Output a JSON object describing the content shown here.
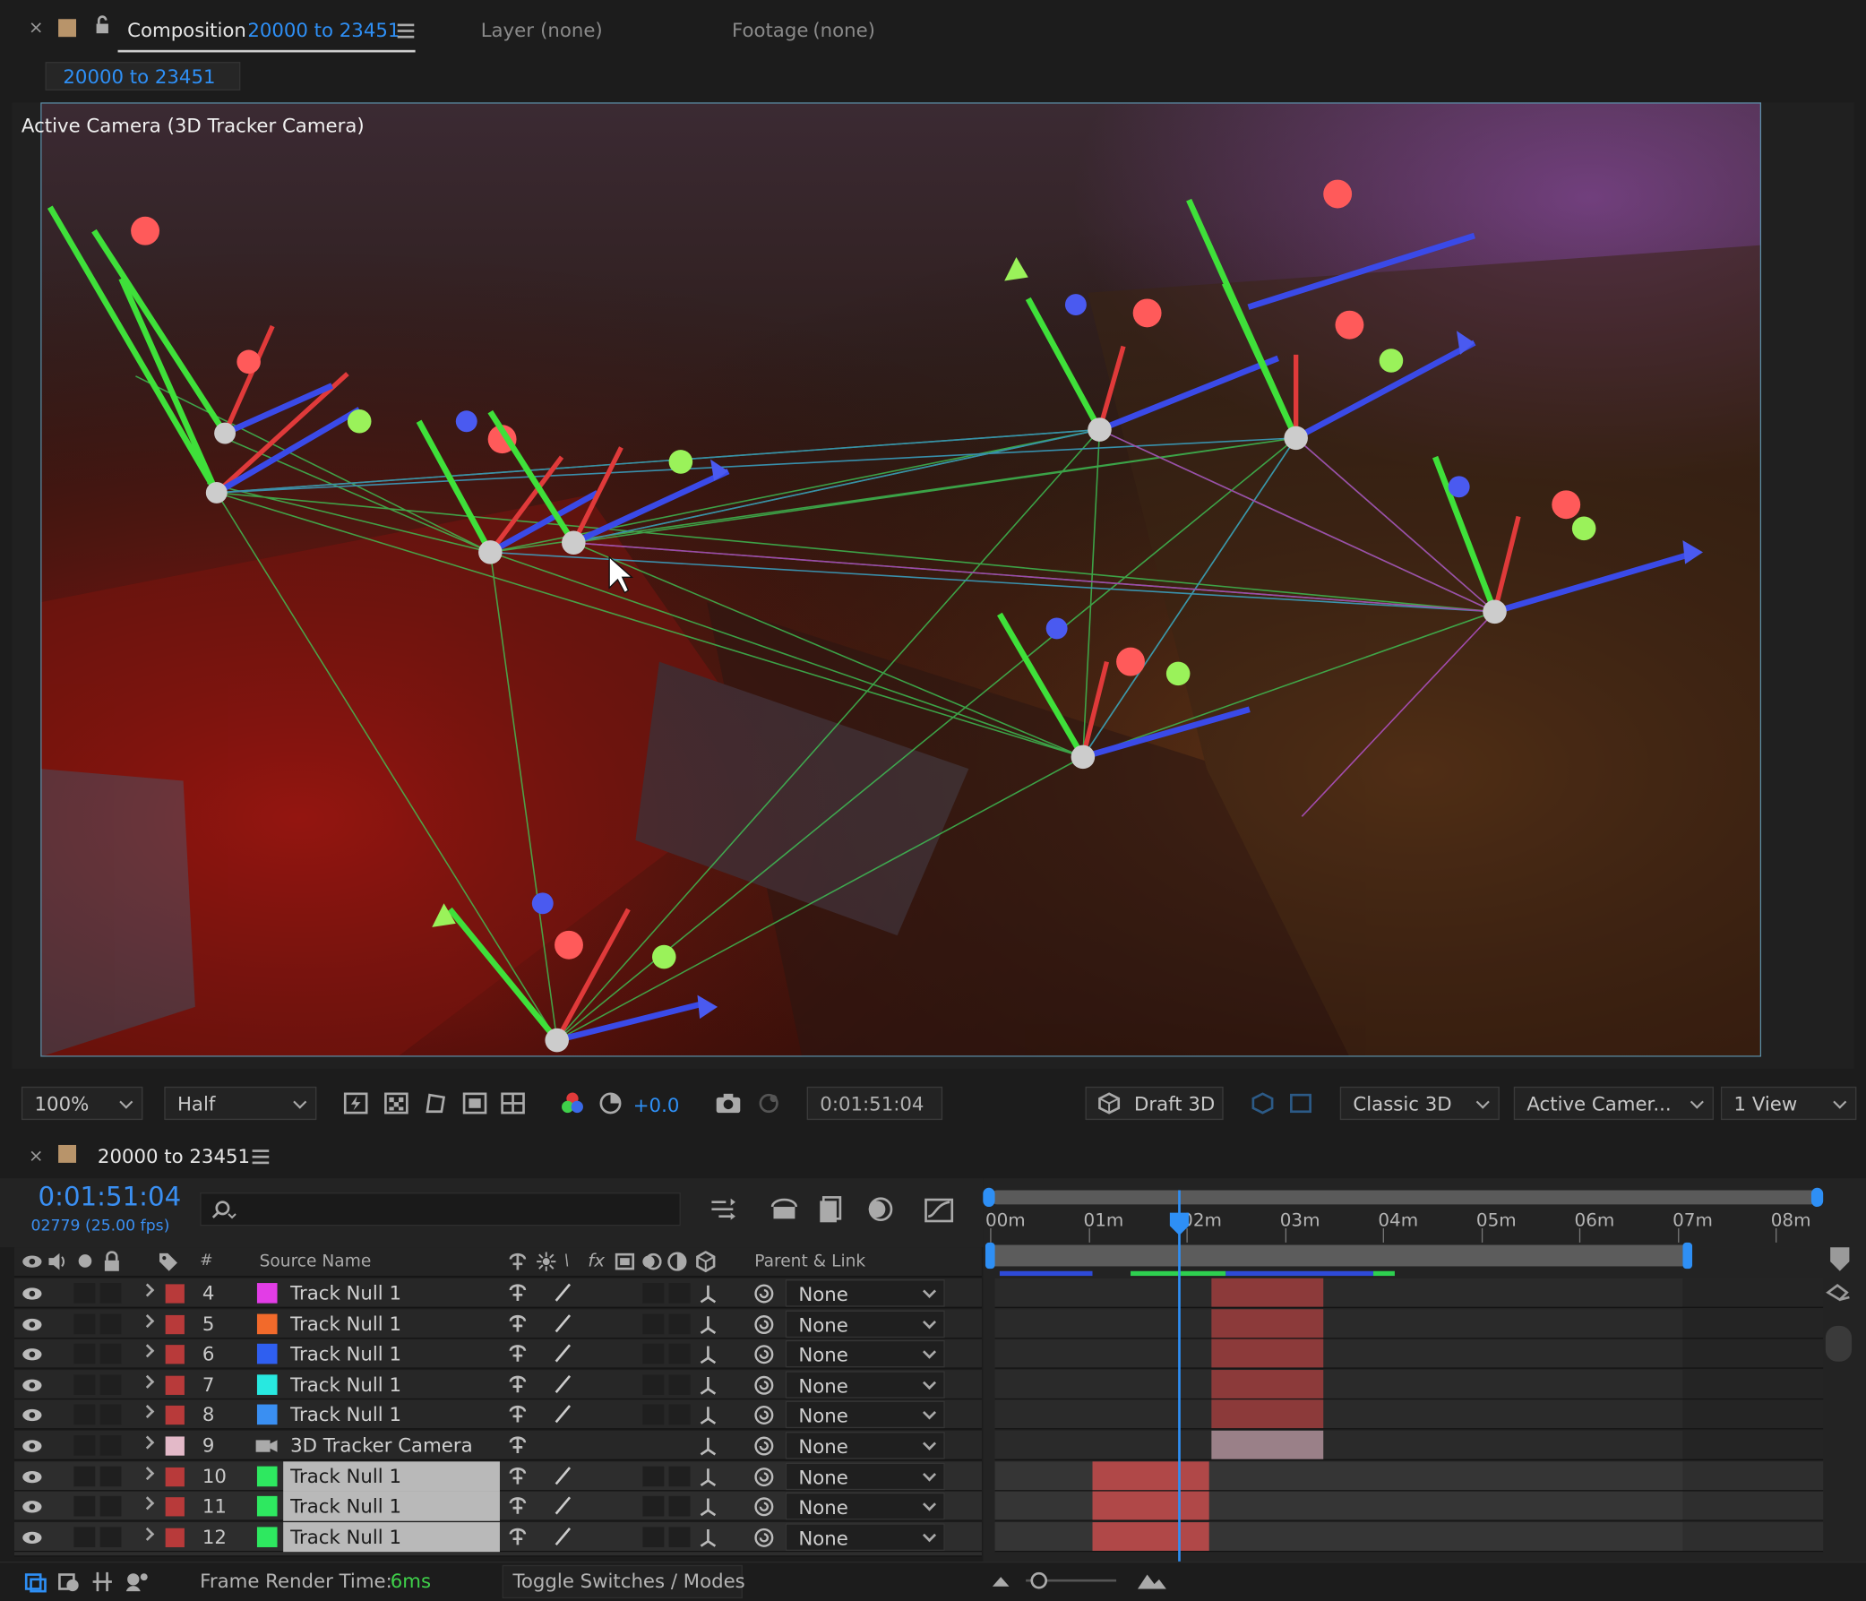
{
  "panel_tabs": {
    "composition_label": "Composition",
    "composition_name": "20000 to 23451",
    "layer_label": "Layer",
    "layer_value": "(none)",
    "footage_label": "Footage",
    "footage_value": "(none)",
    "breadcrumb": "20000 to 23451"
  },
  "viewer": {
    "camera_label": "Active Camera (3D Tracker Camera)"
  },
  "viewer_toolbar": {
    "zoom": "100%",
    "resolution": "Half",
    "exposure": "+0.0",
    "timecode": "0:01:51:04",
    "draft3d": "Draft 3D",
    "renderer": "Classic 3D",
    "camera_view": "Active Camer...",
    "views": "1 View"
  },
  "timeline": {
    "tab_name": "20000 to 23451",
    "current_time": "0:01:51:04",
    "frame_info": "02779 (25.00 fps)",
    "search_placeholder": "",
    "col_number": "#",
    "col_source": "Source Name",
    "col_parent": "Parent & Link",
    "ruler": [
      "00m",
      "01m",
      "02m",
      "03m",
      "04m",
      "05m",
      "06m",
      "07m",
      "08m"
    ],
    "layers": [
      {
        "num": "4",
        "name": "Track Null 1",
        "color": "#e23de6",
        "label": "#b83a3a",
        "parent": "None",
        "selected": false,
        "kind": "null"
      },
      {
        "num": "5",
        "name": "Track Null 1",
        "color": "#f26a2b",
        "label": "#b83a3a",
        "parent": "None",
        "selected": false,
        "kind": "null"
      },
      {
        "num": "6",
        "name": "Track Null 1",
        "color": "#2f5ff0",
        "label": "#b83a3a",
        "parent": "None",
        "selected": false,
        "kind": "null"
      },
      {
        "num": "7",
        "name": "Track Null 1",
        "color": "#28e8e0",
        "label": "#b83a3a",
        "parent": "None",
        "selected": false,
        "kind": "null"
      },
      {
        "num": "8",
        "name": "Track Null 1",
        "color": "#3a8ff2",
        "label": "#b83a3a",
        "parent": "None",
        "selected": false,
        "kind": "null"
      },
      {
        "num": "9",
        "name": "3D Tracker Camera",
        "color": "",
        "label": "#e3b9c8",
        "parent": "None",
        "selected": false,
        "kind": "camera"
      },
      {
        "num": "10",
        "name": "Track Null 1",
        "color": "#2ee860",
        "label": "#b83a3a",
        "parent": "None",
        "selected": true,
        "kind": "null"
      },
      {
        "num": "11",
        "name": "Track Null 1",
        "color": "#2ee860",
        "label": "#b83a3a",
        "parent": "None",
        "selected": true,
        "kind": "null"
      },
      {
        "num": "12",
        "name": "Track Null 1",
        "color": "#2ee860",
        "label": "#b83a3a",
        "parent": "None",
        "selected": true,
        "kind": "null"
      }
    ]
  },
  "status_bar": {
    "frame_render_label": "Frame Render Time:",
    "frame_render_value": "6ms",
    "toggle_label": "Toggle Switches / Modes"
  }
}
